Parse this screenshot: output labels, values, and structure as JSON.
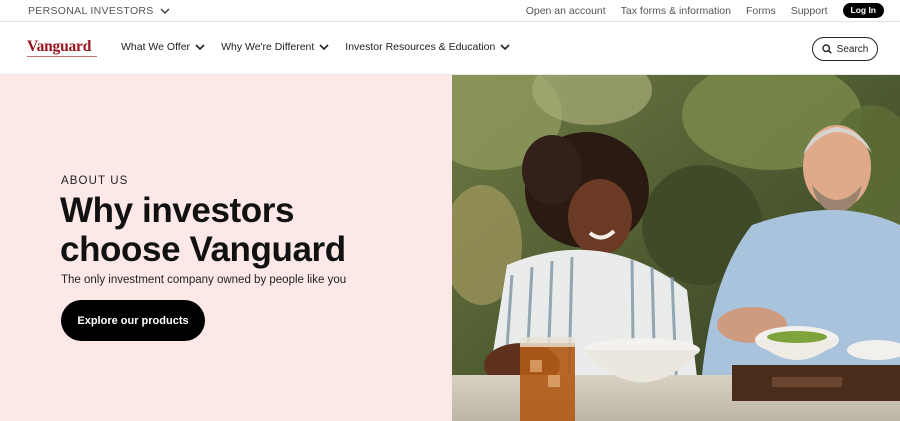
{
  "utility": {
    "segment": "PERSONAL INVESTORS",
    "links": [
      "Open an account",
      "Tax forms & information",
      "Forms",
      "Support"
    ],
    "login": "Log In"
  },
  "header": {
    "logo": "Vanguard",
    "nav": [
      "What We Offer",
      "Why We're Different",
      "Investor Resources & Education"
    ],
    "search": "Search"
  },
  "hero": {
    "eyebrow": "ABOUT US",
    "headline_line1": "Why investors",
    "headline_line2": "choose Vanguard",
    "subtext": "The only investment company owned by people like you",
    "cta": "Explore our products"
  },
  "colors": {
    "brand_red": "#96151d",
    "hero_background": "#fce8e6",
    "button_black": "#000000"
  },
  "icons": {
    "segment_dropdown": "chevron-down-icon",
    "nav_dropdown": "chevron-down-icon",
    "search": "search-icon"
  }
}
